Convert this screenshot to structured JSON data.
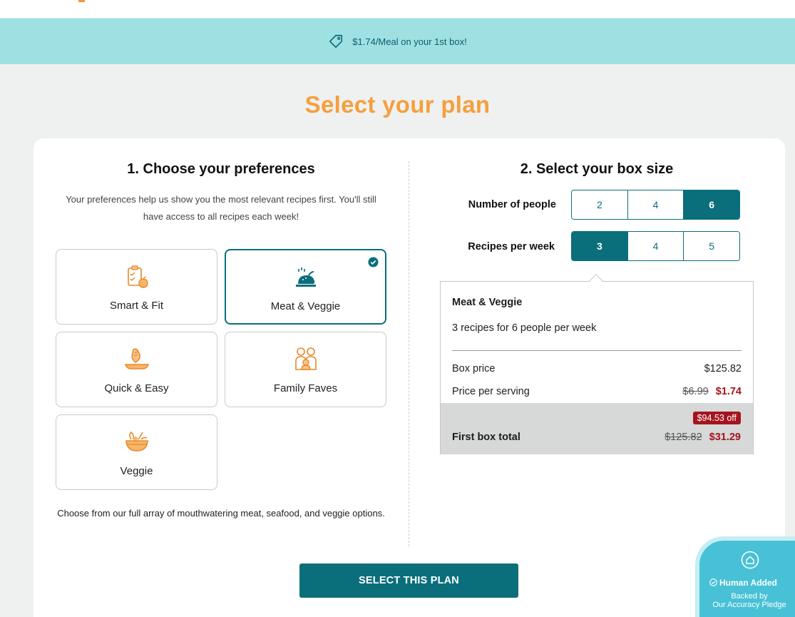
{
  "promo": {
    "text": "$1.74/Meal on your 1st box!",
    "icon": "tag-icon"
  },
  "page_title": "Select your plan",
  "preferences": {
    "heading": "1. Choose your preferences",
    "subtitle": "Your preferences help us show you the most relevant recipes first. You'll still have access to all recipes each week!",
    "options": [
      {
        "label": "Smart & Fit",
        "icon": "clipboard-apple-icon",
        "selected": false
      },
      {
        "label": "Meat & Veggie",
        "icon": "roast-chicken-icon",
        "selected": true
      },
      {
        "label": "Quick & Easy",
        "icon": "hand-pan-icon",
        "selected": false
      },
      {
        "label": "Family Faves",
        "icon": "family-icon",
        "selected": false
      },
      {
        "label": "Veggie",
        "icon": "salad-bowl-icon",
        "selected": false
      }
    ],
    "footer": "Choose from our full array of mouthwatering meat, seafood, and veggie options."
  },
  "box_size": {
    "heading": "2. Select your box size",
    "people_label": "Number of people",
    "people_options": [
      "2",
      "4",
      "6"
    ],
    "people_selected": "6",
    "recipes_label": "Recipes per week",
    "recipes_options": [
      "3",
      "4",
      "5"
    ],
    "recipes_selected": "3"
  },
  "summary": {
    "plan": "Meat & Veggie",
    "description": "3 recipes for 6 people per week",
    "box_price_label": "Box price",
    "box_price": "$125.82",
    "per_serving_label": "Price per serving",
    "per_serving_old": "$6.99",
    "per_serving_new": "$1.74",
    "discount_badge": "$94.53 off",
    "total_label": "First box total",
    "total_old": "$125.82",
    "total_new": "$31.29"
  },
  "cta_label": "SELECT THIS PLAN",
  "pledge": {
    "title": "Human Added",
    "line1": "Backed by",
    "line2": "Our Accuracy Pledge"
  },
  "colors": {
    "accent_orange": "#f59f3f",
    "teal": "#0b6e7b",
    "promo_bg": "#9fe0e2",
    "price_red": "#a5141e"
  }
}
